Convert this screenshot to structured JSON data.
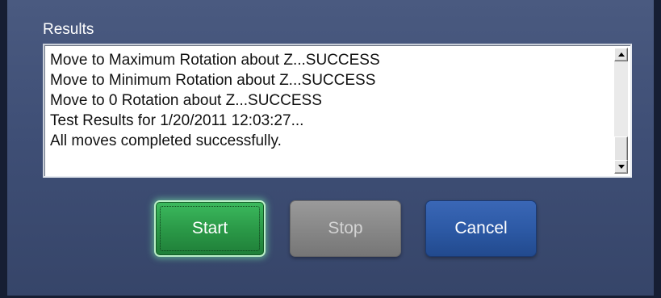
{
  "results": {
    "label": "Results",
    "lines": [
      "Move to Maximum Rotation about Z...SUCCESS",
      "Move to Minimum Rotation about Z...SUCCESS",
      "Move to 0 Rotation about Z...SUCCESS",
      "Test Results for 1/20/2011 12:03:27...",
      "All moves completed successfully."
    ]
  },
  "scrollbar": {
    "up_icon": "arrow-up-icon",
    "down_icon": "arrow-down-icon"
  },
  "buttons": {
    "start_label": "Start",
    "stop_label": "Stop",
    "cancel_label": "Cancel",
    "start_color": "#2b9a48",
    "stop_color": "#888888",
    "cancel_color": "#2d5aa6",
    "stop_enabled": false
  }
}
